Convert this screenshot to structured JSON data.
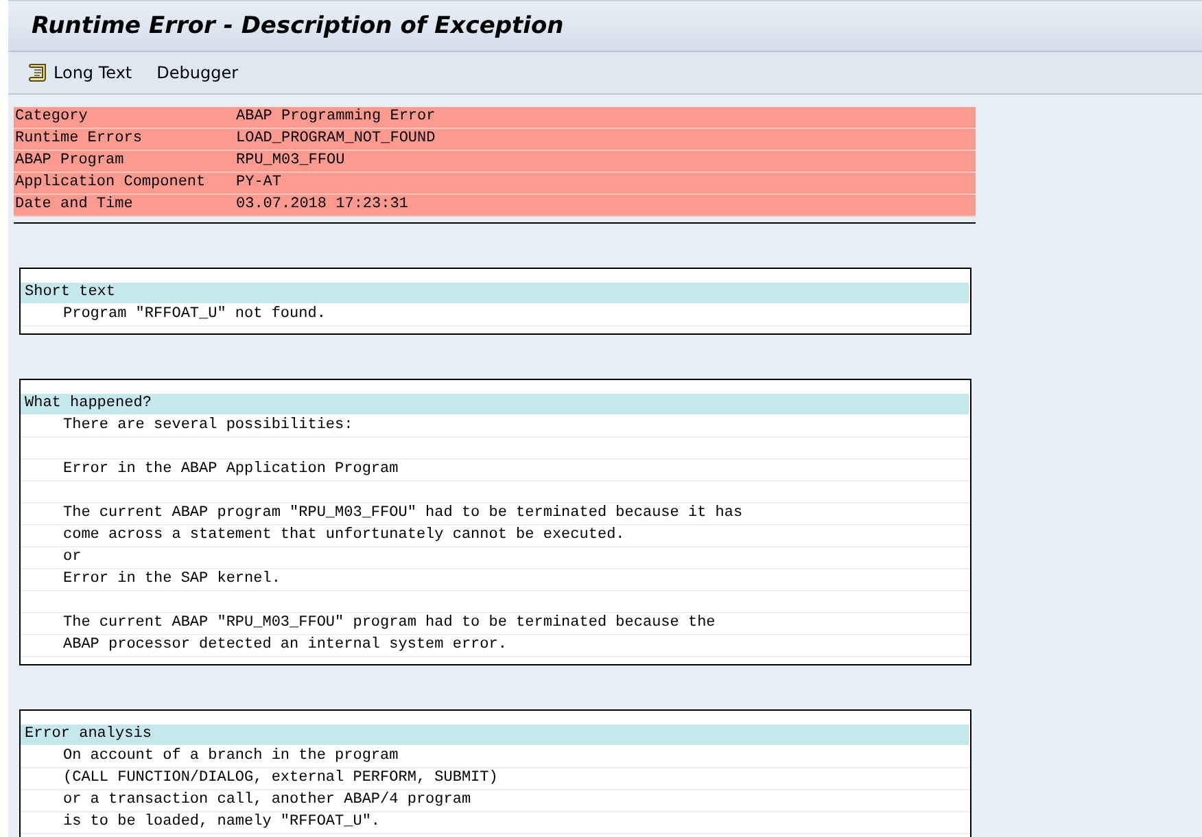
{
  "window": {
    "title": "Runtime Error - Description of Exception"
  },
  "toolbar": [
    {
      "label": "Long Text",
      "kind": "icon"
    },
    {
      "label": "Debugger",
      "kind": "plain"
    }
  ],
  "summary": [
    {
      "label": "Category",
      "value": "ABAP Programming Error"
    },
    {
      "label": "Runtime Errors",
      "value": "LOAD_PROGRAM_NOT_FOUND"
    },
    {
      "label": "ABAP Program",
      "value": "RPU_M03_FFOU"
    },
    {
      "label": "Application Component",
      "value": "PY-AT"
    },
    {
      "label": "Date and Time",
      "value": "03.07.2018 17:23:31"
    }
  ],
  "sections": [
    {
      "heading": "Short text",
      "paragraphs": [
        [
          "Program \"RFFOAT_U\" not found."
        ]
      ]
    },
    {
      "heading": "What happened?",
      "paragraphs": [
        [
          "There are several possibilities:"
        ],
        [
          "Error in the ABAP Application Program"
        ],
        [
          "The current ABAP program \"RPU_M03_FFOU\" had to be terminated because it has",
          "come across a statement that unfortunately cannot be executed.",
          "or",
          "Error in the SAP kernel."
        ],
        [
          "The current ABAP \"RPU_M03_FFOU\" program had to be terminated because the",
          "ABAP processor detected an internal system error."
        ]
      ]
    },
    {
      "heading": "Error analysis",
      "paragraphs": [
        [
          "On account of a branch in the program",
          "(CALL FUNCTION/DIALOG, external PERFORM, SUBMIT)",
          "or a transaction call, another ABAP/4 program",
          "is to be loaded, namely \"RFFOAT_U\"."
        ]
      ]
    }
  ]
}
